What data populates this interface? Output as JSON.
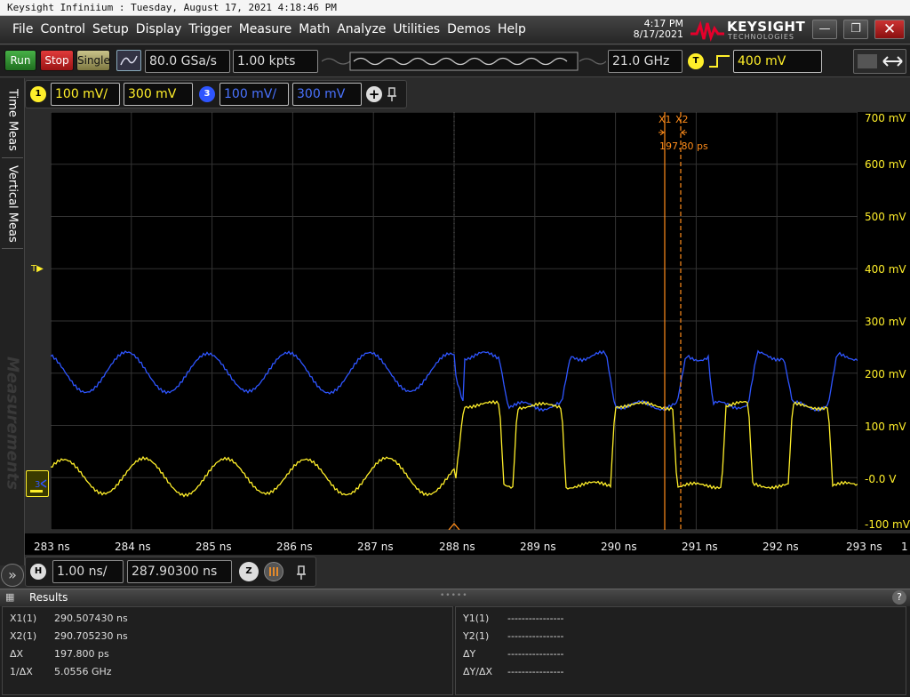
{
  "window": {
    "title": "Keysight Infiniium : Tuesday, August 17, 2021 4:18:46 PM"
  },
  "menu": [
    "File",
    "Control",
    "Setup",
    "Display",
    "Trigger",
    "Measure",
    "Math",
    "Analyze",
    "Utilities",
    "Demos",
    "Help"
  ],
  "clock": {
    "time": "4:17 PM",
    "date": "8/17/2021"
  },
  "logo": {
    "name": "KEYSIGHT",
    "sub": "TECHNOLOGIES"
  },
  "window_buttons": {
    "minimize": "—",
    "restore": "❐",
    "close": "✕"
  },
  "toolbar": {
    "run": "Run",
    "stop": "Stop",
    "single": "Single",
    "sample_rate": "80.0 GSa/s",
    "memory": "1.00 kpts",
    "bandwidth": "21.0 GHz",
    "trigger_badge": "T",
    "trigger_level": "400 mV"
  },
  "channels": {
    "ch1": {
      "badge": "1",
      "scale": "100 mV/",
      "offset": "300 mV",
      "color": "#ffef2a"
    },
    "ch3": {
      "badge": "3",
      "scale": "100 mV/",
      "offset": "300 mV",
      "color": "#2e55ff"
    },
    "add": "+"
  },
  "side_tabs": {
    "time": "Time Meas",
    "vertical": "Vertical Meas",
    "measurements": "Measurements"
  },
  "markers": {
    "x1": "X1",
    "x2": "X2",
    "delta": "197.80 ps",
    "trigger": "T"
  },
  "y_axis": [
    "700 mV",
    "600 mV",
    "500 mV",
    "400 mV",
    "300 mV",
    "200 mV",
    "100 mV",
    "-0.0 V",
    "-100 mV"
  ],
  "x_axis": [
    "283 ns",
    "284 ns",
    "285 ns",
    "286 ns",
    "287 ns",
    "288 ns",
    "289 ns",
    "290 ns",
    "291 ns",
    "292 ns",
    "293 ns"
  ],
  "x_axis_extra": "1",
  "timebase": {
    "badge": "H",
    "scale": "1.00 ns/",
    "position": "287.90300 ns",
    "zoom_badge": "Z"
  },
  "results": {
    "title": "Results",
    "left": [
      {
        "label": "X1(1)",
        "value": "290.507430 ns"
      },
      {
        "label": "X2(1)",
        "value": "290.705230 ns"
      },
      {
        "label": "ΔX",
        "value": "197.800 ps"
      },
      {
        "label": "1/ΔX",
        "value": "5.0556 GHz"
      }
    ],
    "right": [
      {
        "label": "Y1(1)",
        "value": "----------------"
      },
      {
        "label": "Y2(1)",
        "value": "----------------"
      },
      {
        "label": "ΔY",
        "value": "----------------"
      },
      {
        "label": "ΔY/ΔX",
        "value": "----------------"
      }
    ]
  },
  "icons": {
    "expand": "»",
    "help": "?"
  }
}
